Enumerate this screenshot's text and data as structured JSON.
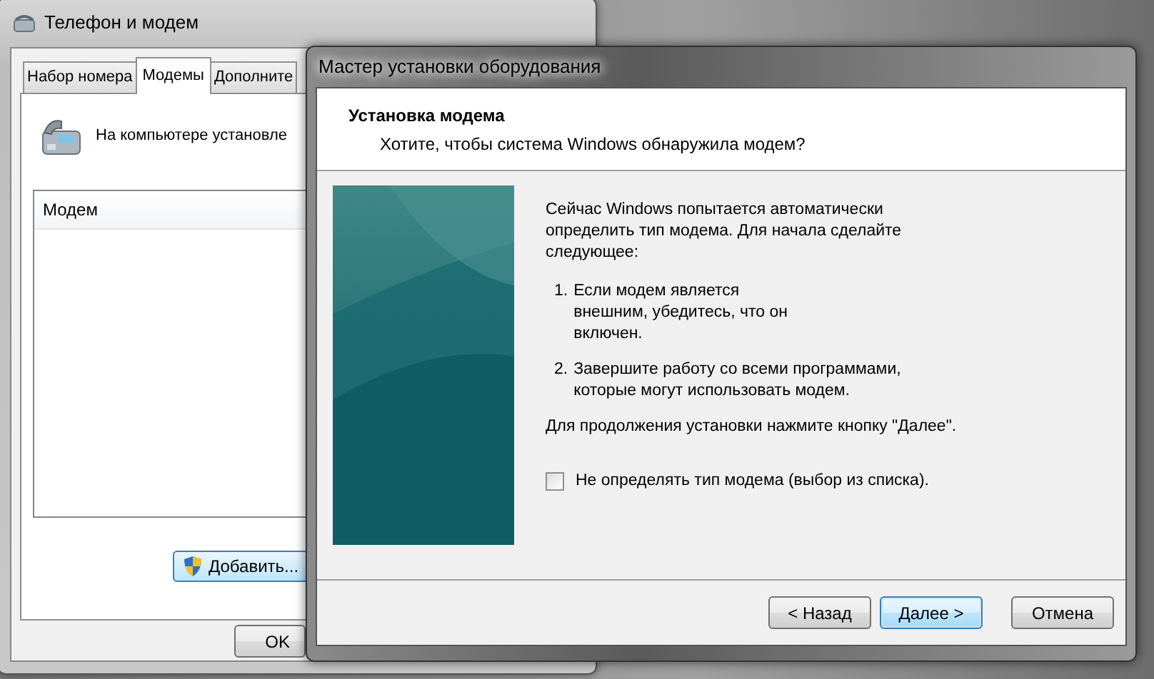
{
  "back_window": {
    "title": "Телефон и модем",
    "tabs": [
      {
        "label": "Набор номера",
        "selected": false
      },
      {
        "label": "Модемы",
        "selected": true
      },
      {
        "label": "Дополните",
        "selected": false
      }
    ],
    "intro": "На компьютере установле",
    "list_header": "Модем",
    "add_button": "Добавить...",
    "ok_button": "OK"
  },
  "wizard": {
    "title": "Мастер установки оборудования",
    "heading": "Установка модема",
    "subheading": "Хотите, чтобы система Windows обнаружила модем?",
    "intro": "Сейчас Windows попытается автоматически определить тип модема. Для начала сделайте следующее:",
    "steps": [
      {
        "number": "1.",
        "text": "Если модем является внешним, убедитесь, что он включен."
      },
      {
        "number": "2.",
        "text": "Завершите работу со всеми программами, которые могут использовать модем."
      }
    ],
    "continue_note": "Для продолжения установки нажмите кнопку \"Далее\".",
    "checkbox": {
      "label": "Не определять тип модема (выбор из списка).",
      "checked": false
    },
    "buttons": [
      {
        "label": "< Назад",
        "selected": false
      },
      {
        "label": "Далее >",
        "selected": true
      },
      {
        "label": "Отмена",
        "selected": false
      }
    ]
  }
}
